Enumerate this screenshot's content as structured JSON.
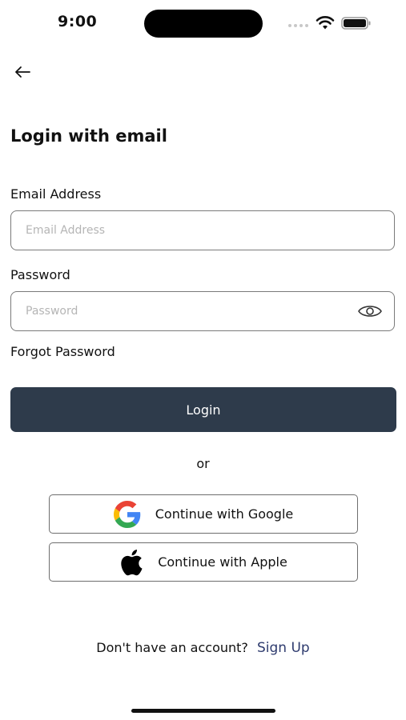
{
  "status_bar": {
    "time": "9:00",
    "icons": [
      "signal-icon",
      "wifi-icon",
      "battery-icon"
    ]
  },
  "header": {
    "back_icon": "arrow-left-icon"
  },
  "page": {
    "title": "Login with email"
  },
  "form": {
    "email_label": "Email Address",
    "email_placeholder": "Email Address",
    "email_value": "",
    "password_label": "Password",
    "password_placeholder": "Password",
    "password_value": "",
    "forgot_label": "Forgot Password",
    "login_label": "Login"
  },
  "divider": {
    "or_label": "or"
  },
  "social": {
    "google_label": "Continue with Google",
    "apple_label": "Continue with Apple"
  },
  "footer": {
    "prompt": "Don't have an account?",
    "signup_label": "Sign Up"
  },
  "colors": {
    "primary_button": "#2e3b4b",
    "link": "#2e3b6e",
    "border": "#7a7a7a"
  }
}
